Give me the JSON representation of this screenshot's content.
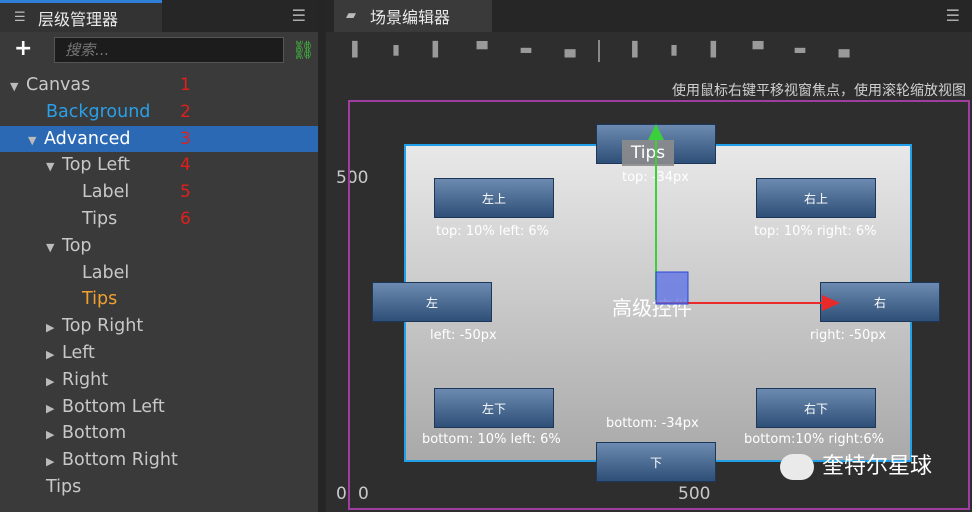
{
  "hierarchy": {
    "title": "层级管理器",
    "search_placeholder": "搜索...",
    "items": [
      {
        "label": "Canvas",
        "num": "1"
      },
      {
        "label": "Background",
        "num": "2"
      },
      {
        "label": "Advanced",
        "num": "3"
      },
      {
        "label": "Top Left",
        "num": "4"
      },
      {
        "label": "Label",
        "num": "5"
      },
      {
        "label": "Tips",
        "num": "6"
      },
      {
        "label": "Top"
      },
      {
        "label": "Label"
      },
      {
        "label": "Tips"
      },
      {
        "label": "Top Right"
      },
      {
        "label": "Left"
      },
      {
        "label": "Right"
      },
      {
        "label": "Bottom Left"
      },
      {
        "label": "Bottom"
      },
      {
        "label": "Bottom Right"
      },
      {
        "label": "Tips"
      }
    ]
  },
  "scene": {
    "title": "场景编辑器",
    "hint": "使用鼠标右键平移视窗焦点，使用滚轮缩放视图",
    "axis": {
      "y500": "500",
      "y0": "0",
      "x0": "0",
      "x500": "500"
    },
    "center_label": "高级控件",
    "buttons": {
      "top_left": "左上",
      "top_right": "右上",
      "left": "左",
      "right": "右",
      "bottom_left": "左下",
      "bottom_right": "右下",
      "bottom": "下"
    },
    "labels": {
      "tips": "Tips",
      "top_offset": "top: -34px",
      "top_left": "top: 10% left: 6%",
      "top_right": "top: 10% right: 6%",
      "left": "left: -50px",
      "right": "right: -50px",
      "bottom_left": "bottom: 10% left: 6%",
      "bottom": "bottom: -34px",
      "bottom_right": "bottom:10% right:6%"
    }
  },
  "watermark": "奎特尔星球",
  "colors": {
    "selection": "#2b69b5",
    "accent_blue": "#2f7ed8",
    "num_red": "#e0201c",
    "highlight_orange": "#f0a030",
    "background_item": "#2aa0e8"
  }
}
